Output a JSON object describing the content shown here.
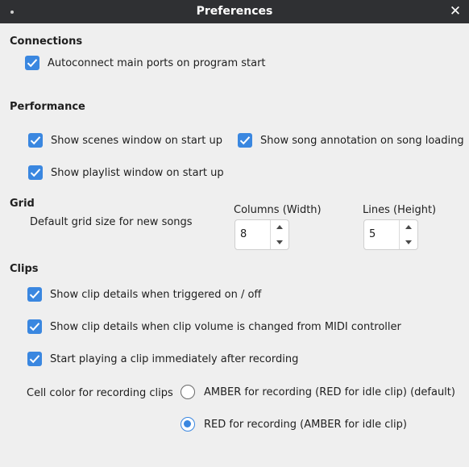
{
  "window": {
    "title": "Preferences"
  },
  "connections": {
    "header": "Connections",
    "autoconnect": {
      "label": "Autoconnect main ports on program start",
      "checked": true
    }
  },
  "performance": {
    "header": "Performance",
    "show_scenes": {
      "label": "Show scenes window on start up",
      "checked": true
    },
    "show_annotation": {
      "label": "Show song annotation on song loading",
      "checked": true
    },
    "show_playlist": {
      "label": "Show playlist window on start up",
      "checked": true
    }
  },
  "grid": {
    "header": "Grid",
    "description": "Default grid size for new songs",
    "columns": {
      "label": "Columns (Width)",
      "value": "8"
    },
    "lines": {
      "label": "Lines (Height)",
      "value": "5"
    }
  },
  "clips": {
    "header": "Clips",
    "details_triggered": {
      "label": "Show clip details when triggered on / off",
      "checked": true
    },
    "details_volume": {
      "label": "Show clip details when clip volume is changed from MIDI controller",
      "checked": true
    },
    "play_after_record": {
      "label": "Start playing a clip immediately after recording",
      "checked": true
    },
    "cell_color": {
      "label": "Cell color for recording clips",
      "options": [
        {
          "label": "AMBER for recording (RED for idle clip) (default)",
          "selected": false
        },
        {
          "label": "RED for recording (AMBER for idle clip)",
          "selected": true
        }
      ]
    }
  },
  "colors": {
    "accent": "#3a87e0",
    "titlebar": "#2f3033",
    "background": "#efefef"
  }
}
